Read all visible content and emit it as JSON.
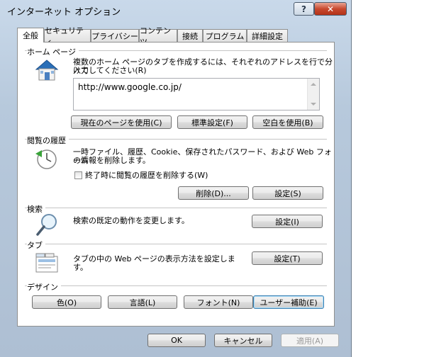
{
  "window": {
    "title": "インターネット オプション",
    "help_label": "?",
    "close_label": "✕"
  },
  "tabs": [
    {
      "label": "全般",
      "active": true
    },
    {
      "label": "セキュリティ",
      "active": false
    },
    {
      "label": "プライバシー",
      "active": false
    },
    {
      "label": "コンテンツ",
      "active": false
    },
    {
      "label": "接続",
      "active": false
    },
    {
      "label": "プログラム",
      "active": false
    },
    {
      "label": "詳細設定",
      "active": false
    }
  ],
  "home": {
    "label": "ホーム ページ",
    "description_line1": "複数のホーム ページのタブを作成するには、それぞれのアドレスを行で分けて",
    "description_line2": "入力してください(R)",
    "url_value": "http://www.google.co.jp/",
    "use_current": "現在のページを使用(C)",
    "use_default": "標準設定(F)",
    "use_blank": "空白を使用(B)"
  },
  "history": {
    "label": "閲覧の履歴",
    "description_line1": "一時ファイル、履歴、Cookie、保存されたパスワード、および Web フォーム",
    "description_line2": "の情報を削除します。",
    "checkbox_label": "終了時に閲覧の履歴を削除する(W)",
    "delete_label": "削除(D)...",
    "settings_label": "設定(S)"
  },
  "search": {
    "label": "検索",
    "description": "検索の既定の動作を変更します。",
    "settings_label": "設定(I)"
  },
  "tabs_section": {
    "label": "タブ",
    "description_line1": "タブの中の Web ページの表示方法を設定しま",
    "description_line2": "す。",
    "settings_label": "設定(T)"
  },
  "design": {
    "label": "デザイン",
    "colors": "色(O)",
    "languages": "言語(L)",
    "fonts": "フォント(N)",
    "accessibility": "ユーザー補助(E)"
  },
  "footer": {
    "ok": "OK",
    "cancel": "キャンセル",
    "apply": "適用(A)"
  }
}
